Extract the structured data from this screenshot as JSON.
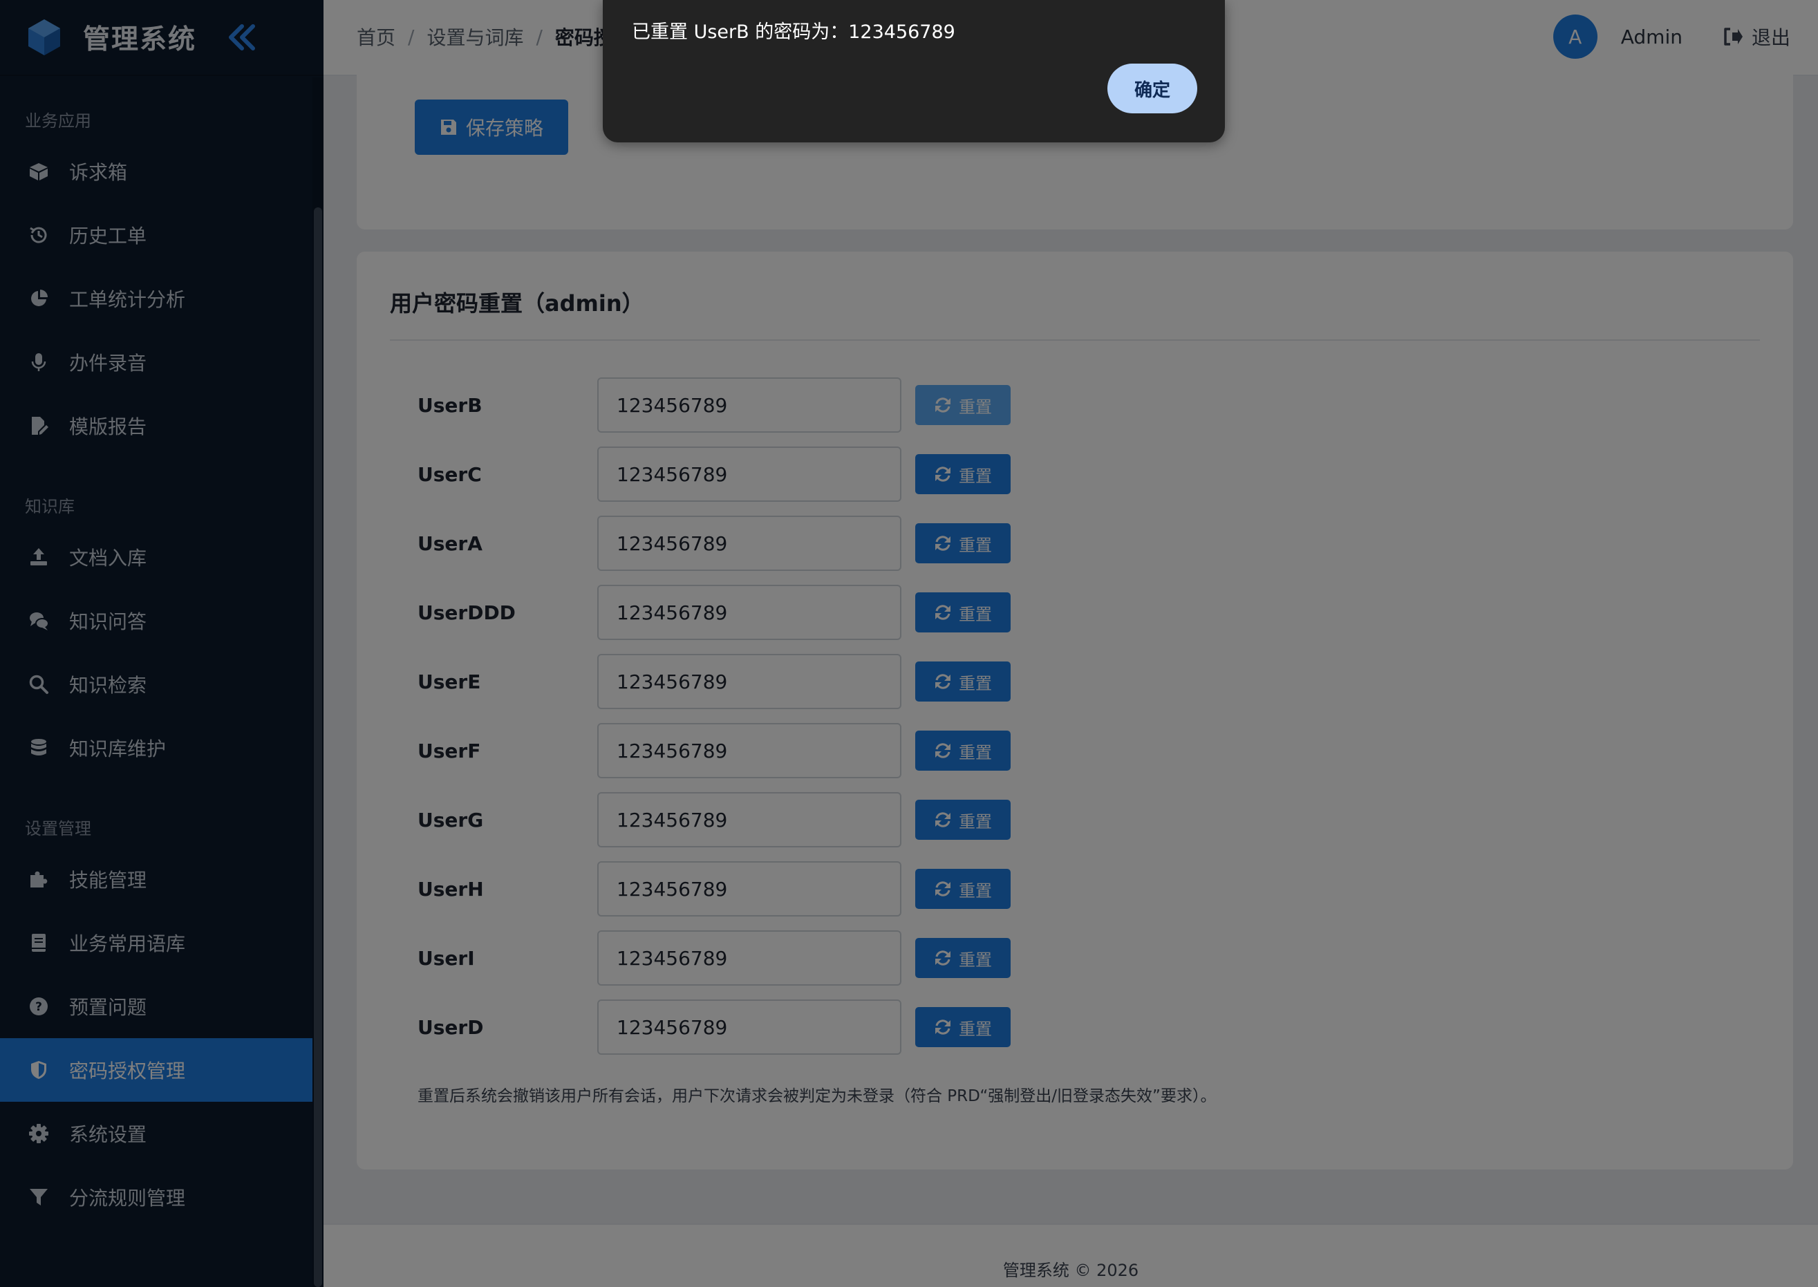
{
  "app": {
    "title": "管理系统"
  },
  "sidebar": {
    "sections": [
      {
        "title": "业务应用",
        "items": [
          {
            "label": "诉求箱",
            "icon": "box-icon"
          },
          {
            "label": "历史工单",
            "icon": "history-icon"
          },
          {
            "label": "工单统计分析",
            "icon": "pie-chart-icon"
          },
          {
            "label": "办件录音",
            "icon": "microphone-icon"
          },
          {
            "label": "模版报告",
            "icon": "file-edit-icon"
          }
        ]
      },
      {
        "title": "知识库",
        "items": [
          {
            "label": "文档入库",
            "icon": "upload-icon"
          },
          {
            "label": "知识问答",
            "icon": "comments-icon"
          },
          {
            "label": "知识检索",
            "icon": "search-icon"
          },
          {
            "label": "知识库维护",
            "icon": "database-icon"
          }
        ]
      },
      {
        "title": "设置管理",
        "items": [
          {
            "label": "技能管理",
            "icon": "puzzle-icon"
          },
          {
            "label": "业务常用语库",
            "icon": "book-icon"
          },
          {
            "label": "预置问题",
            "icon": "question-icon"
          },
          {
            "label": "密码授权管理",
            "icon": "shield-icon",
            "active": true
          },
          {
            "label": "系统设置",
            "icon": "gear-icon"
          },
          {
            "label": "分流规则管理",
            "icon": "filter-icon"
          }
        ]
      }
    ]
  },
  "header": {
    "breadcrumb": [
      "首页",
      "设置与词库",
      "密码授"
    ],
    "separator": "/",
    "avatar_letter": "A",
    "user_name": "Admin",
    "logout_label": "退出"
  },
  "policy_card": {
    "save_label": "保存策略"
  },
  "reset_card": {
    "title": "用户密码重置（admin）",
    "reset_label": "重置",
    "users": [
      {
        "name": "UserB",
        "password": "123456789"
      },
      {
        "name": "UserC",
        "password": "123456789"
      },
      {
        "name": "UserA",
        "password": "123456789"
      },
      {
        "name": "UserDDD",
        "password": "123456789"
      },
      {
        "name": "UserE",
        "password": "123456789"
      },
      {
        "name": "UserF",
        "password": "123456789"
      },
      {
        "name": "UserG",
        "password": "123456789"
      },
      {
        "name": "UserH",
        "password": "123456789"
      },
      {
        "name": "UserI",
        "password": "123456789"
      },
      {
        "name": "UserD",
        "password": "123456789"
      }
    ],
    "note": "重置后系统会撤销该用户所有会话，用户下次请求会被判定为未登录（符合 PRD“强制登出/旧登录态失效”要求）。"
  },
  "footer": {
    "text": "管理系统 © 2026"
  },
  "dialog": {
    "message": "已重置 UserB 的密码为：123456789",
    "ok_label": "确定"
  },
  "colors": {
    "sidebar_bg": "#0d1b2c",
    "accent": "#1f7ce0",
    "dialog_bg": "#232323",
    "dialog_button": "#b5d2f8"
  }
}
